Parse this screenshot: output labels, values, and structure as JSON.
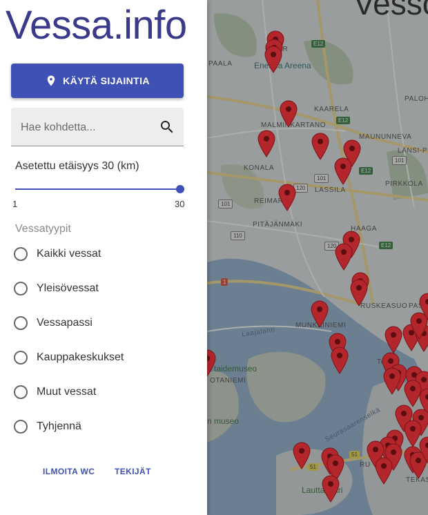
{
  "app": {
    "brand": "Vessa.info",
    "partial_title": "Vesso"
  },
  "colors": {
    "primary": "#3f51b5",
    "marker": "#b3262b",
    "brand_text": "#3a3a8a"
  },
  "location_button": {
    "label": "KÄYTÄ SIJAINTIA",
    "icon": "location-pin-icon"
  },
  "search": {
    "placeholder": "Hae kohdetta...",
    "value": "",
    "icon": "search-icon"
  },
  "distance": {
    "label": "Asetettu etäisyys 30 (km)",
    "min_label": "1",
    "max_label": "30",
    "min": 1,
    "max": 30,
    "value": 30
  },
  "toilet_types": {
    "heading": "Vessatyypit",
    "options": [
      {
        "label": "Kaikki vessat",
        "selected": false
      },
      {
        "label": "Yleisövessat",
        "selected": false
      },
      {
        "label": "Vessapassi",
        "selected": false
      },
      {
        "label": "Kauppakeskukset",
        "selected": false
      },
      {
        "label": "Muut vessat",
        "selected": false
      },
      {
        "label": "Tyhjennä",
        "selected": false
      }
    ]
  },
  "footer": {
    "report_label": "ILMOITA WC",
    "authors_label": "TEKIJÄT"
  },
  "map": {
    "place_labels": [
      "Energia Areena",
      "KAARELA",
      "MALMINKARTANO",
      "MAUNUNNEVA",
      "LÄNSI-P",
      "KONALA",
      "LASSILA",
      "PIRKKOLA",
      "REIMAR",
      "PITÄJÄNMÄKI",
      "HAAGA",
      "RUSKEASUO",
      "PASI",
      "MUNKKINIEMI",
      "Laajalahti",
      "n taidemuseo",
      "OTANIEMI",
      "n museo",
      "Seurasaarenselkä",
      "Lauttasaari",
      "RU",
      "TEKAS",
      "PALOH",
      "MYYR",
      "PAALA",
      "Tem"
    ],
    "road_labels": [
      "E12",
      "E12",
      "E12",
      "E12",
      "101",
      "101",
      "101",
      "110",
      "120",
      "120",
      "1",
      "51",
      "51"
    ]
  }
}
